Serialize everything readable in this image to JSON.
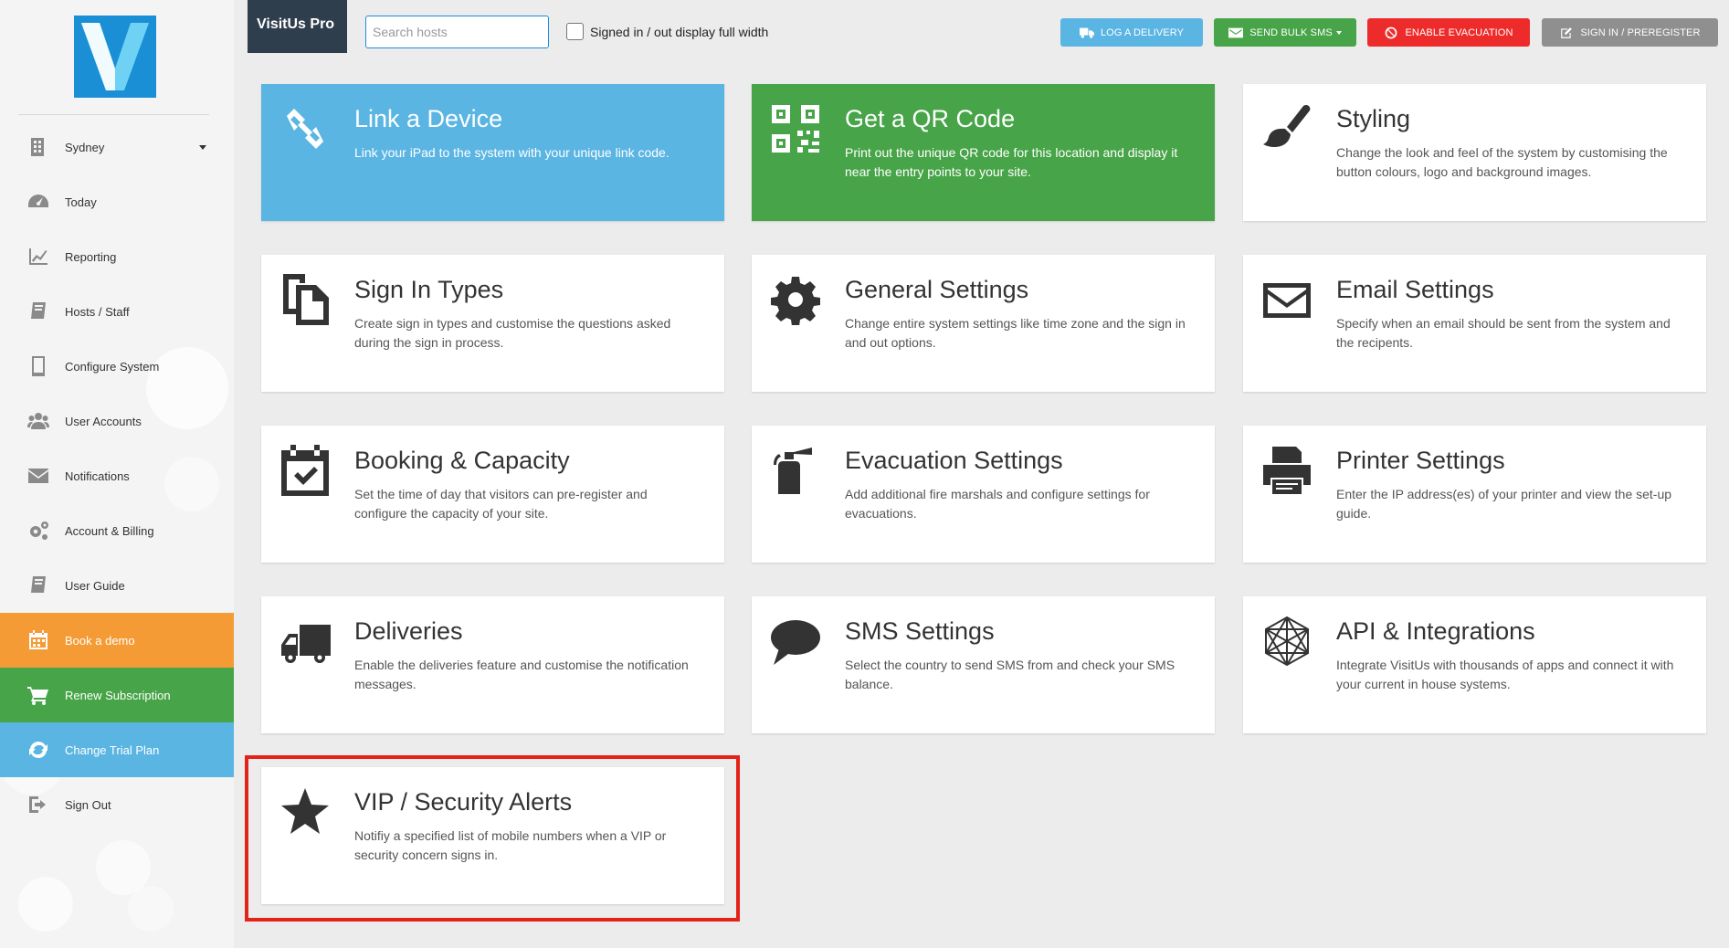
{
  "brand": "VisitUs Pro",
  "search": {
    "placeholder": "Search hosts",
    "value": ""
  },
  "full_width_toggle": {
    "label": "Signed in / out display full width",
    "checked": false
  },
  "top_buttons": {
    "log_delivery": "LOG A DELIVERY",
    "send_bulk_sms": "SEND BULK SMS",
    "enable_evacuation": "ENABLE EVACUATION",
    "sign_in_preregister": "SIGN IN / PREREGISTER"
  },
  "sidebar": {
    "items": [
      {
        "label": "Sydney",
        "icon": "building-icon"
      },
      {
        "label": "Today",
        "icon": "dashboard-icon"
      },
      {
        "label": "Reporting",
        "icon": "line-chart-icon"
      },
      {
        "label": "Hosts / Staff",
        "icon": "book-icon"
      },
      {
        "label": "Configure System",
        "icon": "tablet-icon"
      },
      {
        "label": "User Accounts",
        "icon": "users-icon"
      },
      {
        "label": "Notifications",
        "icon": "envelope-icon"
      },
      {
        "label": "Account & Billing",
        "icon": "cogs-icon"
      },
      {
        "label": "User Guide",
        "icon": "book-icon"
      },
      {
        "label": "Book a demo",
        "icon": "calendar-icon"
      },
      {
        "label": "Renew Subscription",
        "icon": "cart-icon"
      },
      {
        "label": "Change Trial Plan",
        "icon": "refresh-icon"
      },
      {
        "label": "Sign Out",
        "icon": "sign-out-icon"
      }
    ]
  },
  "cards": [
    {
      "title": "Link a Device",
      "desc": "Link your iPad to the system with your unique link code.",
      "icon": "link-icon",
      "color": "#5bb5e3"
    },
    {
      "title": "Get a QR Code",
      "desc": "Print out the unique QR code for this location and display it near the entry points to your site.",
      "icon": "qr-code-icon",
      "color": "#47a448"
    },
    {
      "title": "Styling",
      "desc": "Change the look and feel of the system by customising the button colours, logo and background images.",
      "icon": "paint-brush-icon"
    },
    {
      "title": "Sign In Types",
      "desc": "Create sign in types and customise the questions asked during the sign in process.",
      "icon": "files-icon"
    },
    {
      "title": "General Settings",
      "desc": "Change entire system settings like time zone and the sign in and out options.",
      "icon": "gear-icon"
    },
    {
      "title": "Email Settings",
      "desc": "Specify when an email should be sent from the system and the recipents.",
      "icon": "envelope-icon"
    },
    {
      "title": "Booking & Capacity",
      "desc": "Set the time of day that visitors can pre-register and configure the capacity of your site.",
      "icon": "calendar-check-icon"
    },
    {
      "title": "Evacuation Settings",
      "desc": "Add additional fire marshals and configure settings for evacuations.",
      "icon": "fire-extinguisher-icon"
    },
    {
      "title": "Printer Settings",
      "desc": "Enter the IP address(es) of your printer and view the set-up guide.",
      "icon": "printer-icon"
    },
    {
      "title": "Deliveries",
      "desc": "Enable the deliveries feature and customise the notification messages.",
      "icon": "truck-icon"
    },
    {
      "title": "SMS Settings",
      "desc": "Select the country to send SMS from and check your SMS balance.",
      "icon": "speech-bubble-icon"
    },
    {
      "title": "API & Integrations",
      "desc": "Integrate VisitUs with thousands of apps and connect it with your current in house systems.",
      "icon": "network-icon"
    },
    {
      "title": "VIP / Security Alerts",
      "desc": "Notifiy a specified list of mobile numbers when a VIP or security concern signs in.",
      "icon": "star-icon"
    }
  ],
  "colors": {
    "accent_blue": "#5bb5e3",
    "green": "#47a448",
    "orange": "#f49b36",
    "red": "#ee2b2b",
    "highlight": "#e3231a"
  }
}
